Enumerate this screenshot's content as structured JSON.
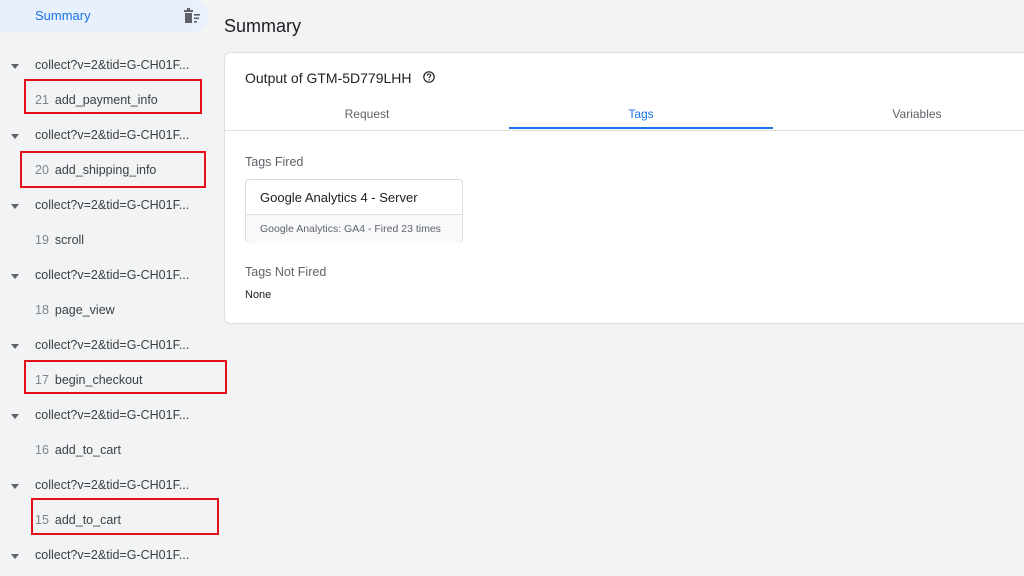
{
  "sidebar": {
    "summary_label": "Summary",
    "groups": [
      {
        "title": "collect?v=2&tid=G-CH01F...",
        "event_num": "21",
        "event_name": "add_payment_info"
      },
      {
        "title": "collect?v=2&tid=G-CH01F...",
        "event_num": "20",
        "event_name": "add_shipping_info"
      },
      {
        "title": "collect?v=2&tid=G-CH01F...",
        "event_num": "19",
        "event_name": "scroll"
      },
      {
        "title": "collect?v=2&tid=G-CH01F...",
        "event_num": "18",
        "event_name": "page_view"
      },
      {
        "title": "collect?v=2&tid=G-CH01F...",
        "event_num": "17",
        "event_name": "begin_checkout"
      },
      {
        "title": "collect?v=2&tid=G-CH01F...",
        "event_num": "16",
        "event_name": "add_to_cart"
      },
      {
        "title": "collect?v=2&tid=G-CH01F...",
        "event_num": "15",
        "event_name": "add_to_cart"
      },
      {
        "title": "collect?v=2&tid=G-CH01F..."
      }
    ]
  },
  "main": {
    "title": "Summary",
    "card_title": "Output of GTM-5D779LHH",
    "tabs": [
      {
        "label": "Request"
      },
      {
        "label": "Tags"
      },
      {
        "label": "Variables"
      }
    ],
    "active_tab": "Tags",
    "tags_fired_label": "Tags Fired",
    "fired_tag": {
      "name": "Google Analytics 4 - Server",
      "detail": "Google Analytics: GA4 - Fired 23 times"
    },
    "tags_not_fired_label": "Tags Not Fired",
    "not_fired_value": "None"
  },
  "colors": {
    "accent": "#1a73e8",
    "highlight_box": "#e3101b",
    "summary_bg": "#e8f0fe"
  },
  "icons": {
    "clear": "delete-sweep-icon",
    "help": "help-circle-icon",
    "expand": "caret-down-icon"
  }
}
